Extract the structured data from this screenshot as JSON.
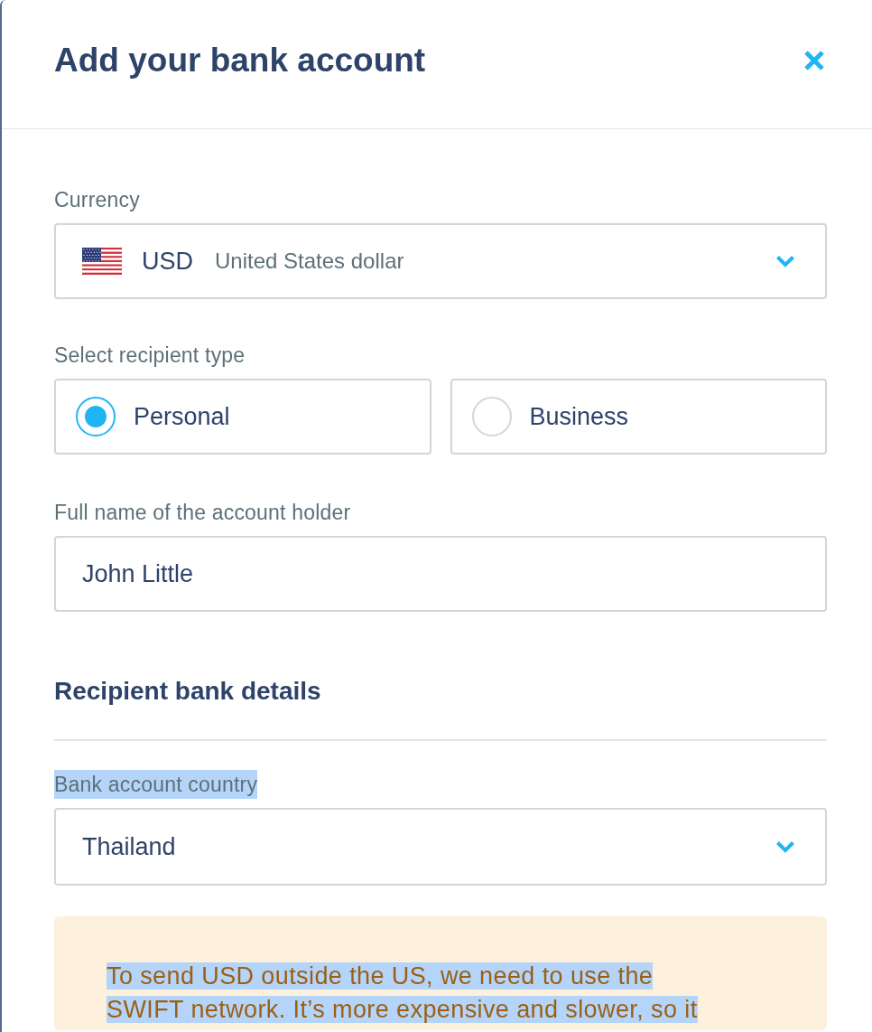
{
  "modal": {
    "title": "Add your bank account"
  },
  "currency": {
    "label": "Currency",
    "code": "USD",
    "name": "United States dollar"
  },
  "recipient_type": {
    "label": "Select recipient type",
    "options": [
      {
        "label": "Personal",
        "selected": true
      },
      {
        "label": "Business",
        "selected": false
      }
    ]
  },
  "account_holder": {
    "label": "Full name of the account holder",
    "value": "John Little"
  },
  "bank_details": {
    "heading": "Recipient bank details",
    "country": {
      "label": "Bank account country",
      "text_selected": true,
      "value": "Thailand"
    }
  },
  "notice": {
    "lines": [
      "To send USD outside the US, we need to use the",
      "SWIFT network. It’s more expensive and slower, so it"
    ],
    "text_selected": true
  }
}
